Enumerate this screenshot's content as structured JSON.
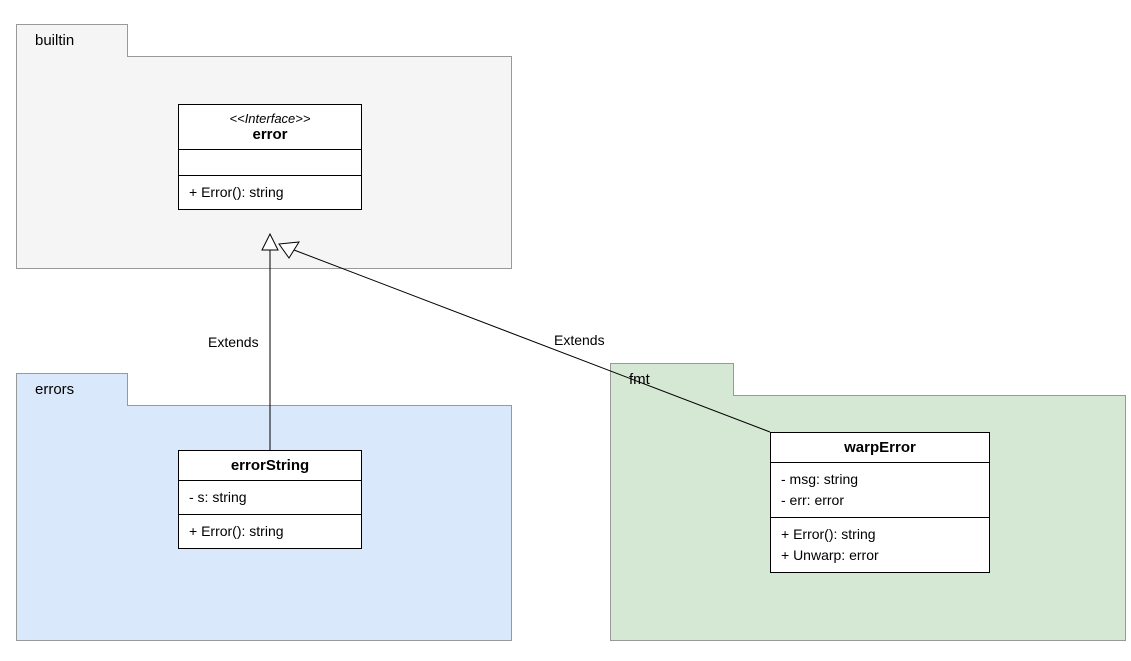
{
  "packages": {
    "builtin": {
      "label": "builtin"
    },
    "errors": {
      "label": "errors"
    },
    "fmt": {
      "label": "fmt"
    }
  },
  "classes": {
    "error": {
      "stereotype": "<<Interface>>",
      "name": "error",
      "attributes": "",
      "methods": "+ Error(): string"
    },
    "errorString": {
      "name": "errorString",
      "attributes": "- s: string",
      "methods": "+ Error(): string"
    },
    "warpError": {
      "name": "warpError",
      "attr1": "- msg: string",
      "attr2": "- err: error",
      "method1": "+ Error(): string",
      "method2": "+ Unwarp: error"
    }
  },
  "relationships": {
    "extends1": "Extends",
    "extends2": "Extends"
  }
}
